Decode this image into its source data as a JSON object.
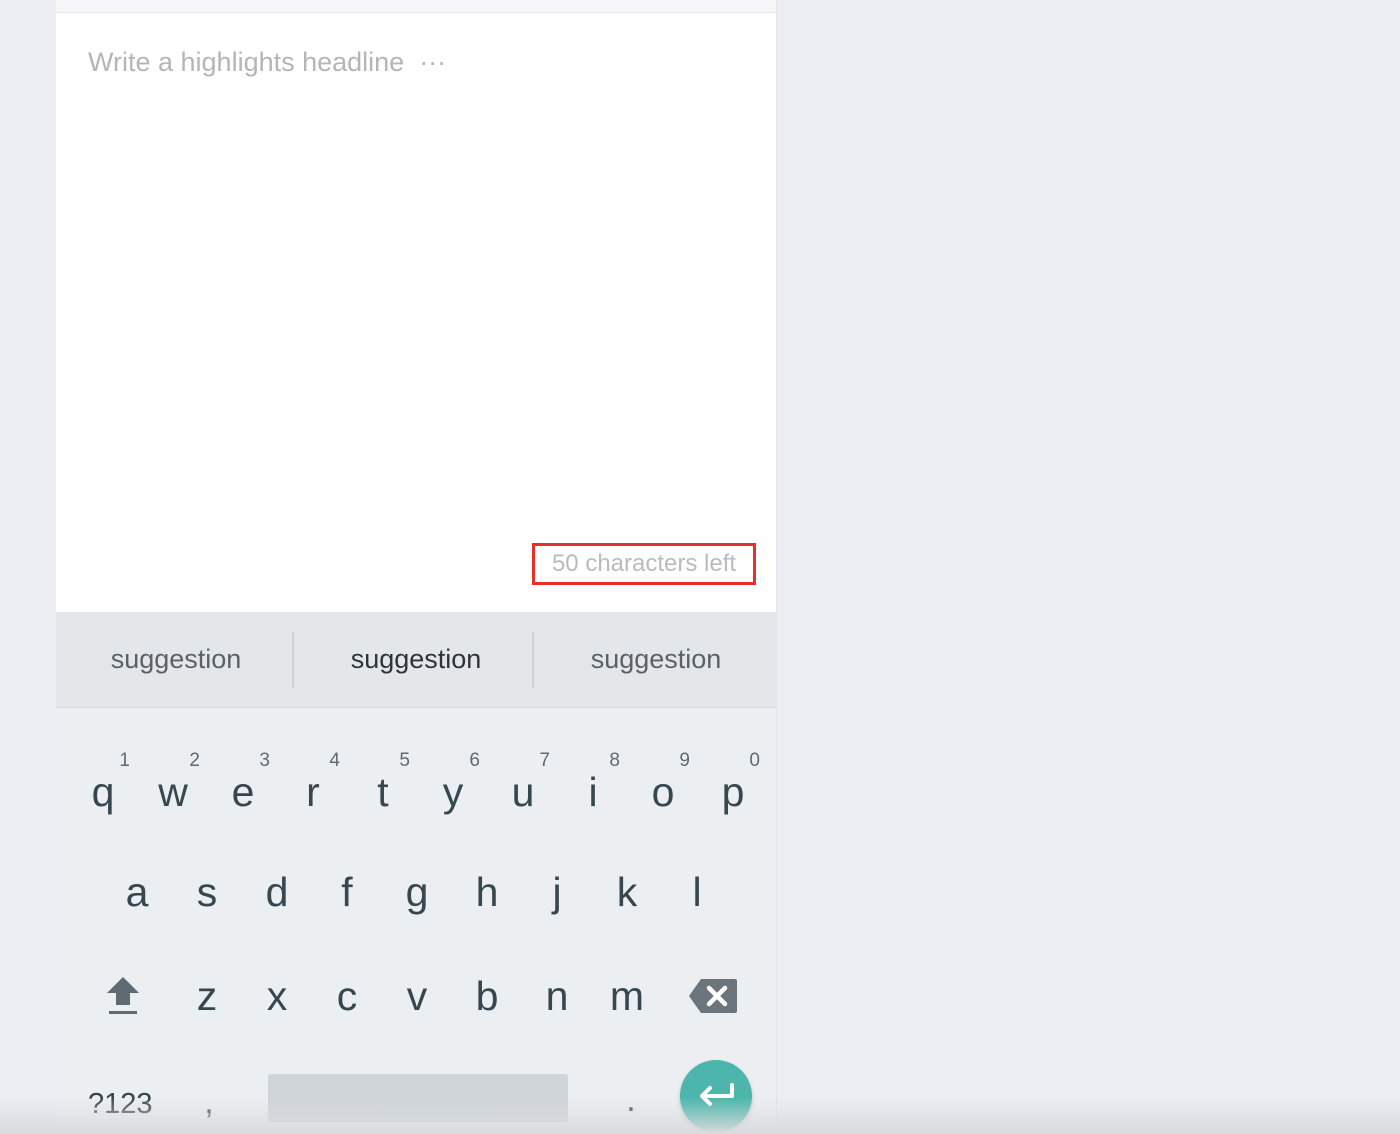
{
  "editor": {
    "headline_placeholder": "Write a highlights headline  ···",
    "char_count": "50 characters left"
  },
  "keyboard": {
    "suggestions": [
      "suggestion",
      "suggestion",
      "suggestion"
    ],
    "row1": [
      {
        "letter": "q",
        "num": "1"
      },
      {
        "letter": "w",
        "num": "2"
      },
      {
        "letter": "e",
        "num": "3"
      },
      {
        "letter": "r",
        "num": "4"
      },
      {
        "letter": "t",
        "num": "5"
      },
      {
        "letter": "y",
        "num": "6"
      },
      {
        "letter": "u",
        "num": "7"
      },
      {
        "letter": "i",
        "num": "8"
      },
      {
        "letter": "o",
        "num": "9"
      },
      {
        "letter": "p",
        "num": "0"
      }
    ],
    "row2": [
      "a",
      "s",
      "d",
      "f",
      "g",
      "h",
      "j",
      "k",
      "l"
    ],
    "row3": [
      "z",
      "x",
      "c",
      "v",
      "b",
      "n",
      "m"
    ],
    "symbols_label": "?123",
    "comma_label": ",",
    "period_label": ".",
    "accent_color": "#4db6ac"
  }
}
